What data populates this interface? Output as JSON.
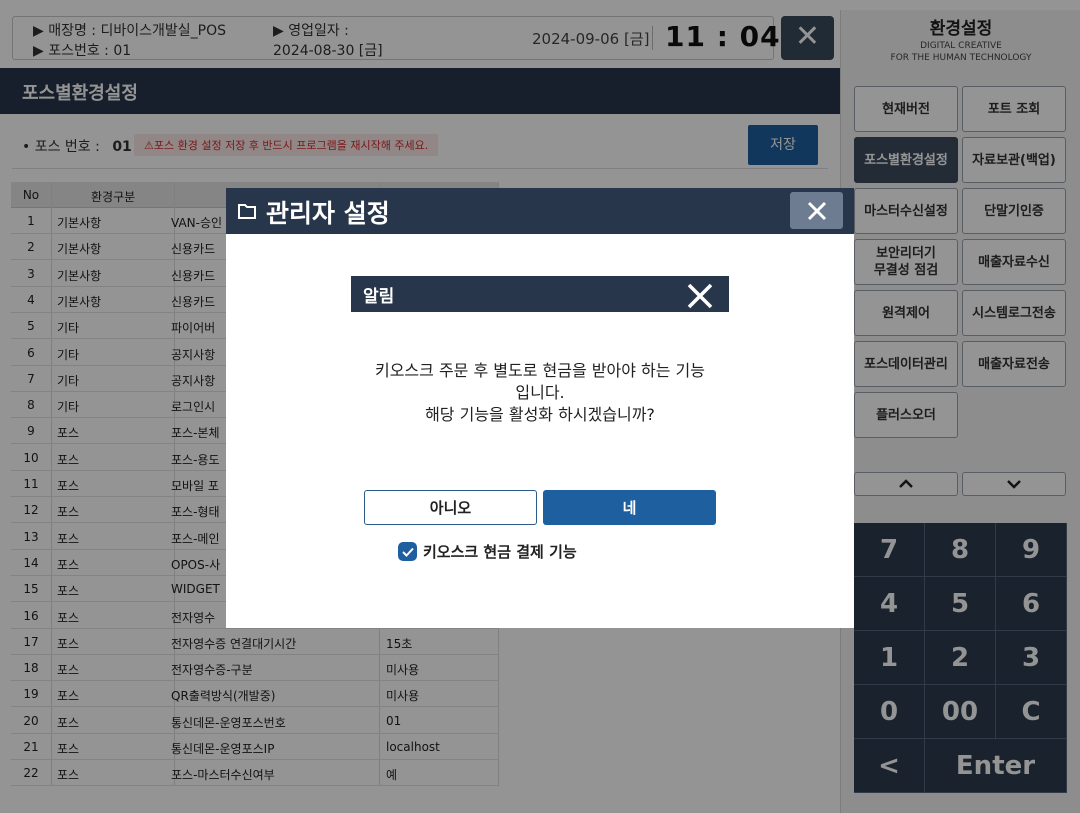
{
  "header": {
    "store_label": "▶ 매장명 : 디바이스개발실_POS",
    "pos_label": "▶ 포스번호 : 01",
    "business_date_label": "▶ 영업일자 :",
    "business_date_value": "2024-08-30 [금]",
    "current_date": "2024-09-06 [금]",
    "clock": "11 : 04",
    "close_icon": "close-icon"
  },
  "page": {
    "title": "포스별환경설정",
    "pos_number_label": "• 포스 번호 :",
    "pos_number_value": "01",
    "warning": "⚠포스 환경 설정 저장 후 반드시 프로그램을 재시작해 주세요.",
    "save_label": "저장"
  },
  "table": {
    "headers": {
      "no": "No",
      "type": "환경구분"
    },
    "rows": [
      {
        "no": "1",
        "type": "기본사항",
        "name": "VAN-승인",
        "value": ""
      },
      {
        "no": "2",
        "type": "기본사항",
        "name": "신용카드",
        "value": ""
      },
      {
        "no": "3",
        "type": "기본사항",
        "name": "신용카드",
        "value": ""
      },
      {
        "no": "4",
        "type": "기본사항",
        "name": "신용카드",
        "value": ""
      },
      {
        "no": "5",
        "type": "기타",
        "name": "파이어버",
        "value": ""
      },
      {
        "no": "6",
        "type": "기타",
        "name": "공지사항",
        "value": ""
      },
      {
        "no": "7",
        "type": "기타",
        "name": "공지사항",
        "value": ""
      },
      {
        "no": "8",
        "type": "기타",
        "name": "로그인시",
        "value": ""
      },
      {
        "no": "9",
        "type": "포스",
        "name": "포스-본체",
        "value": ""
      },
      {
        "no": "10",
        "type": "포스",
        "name": "포스-용도",
        "value": ""
      },
      {
        "no": "11",
        "type": "포스",
        "name": "모바일 포",
        "value": ""
      },
      {
        "no": "12",
        "type": "포스",
        "name": "포스-형태",
        "value": ""
      },
      {
        "no": "13",
        "type": "포스",
        "name": "포스-메인",
        "value": ""
      },
      {
        "no": "14",
        "type": "포스",
        "name": "OPOS-사",
        "value": ""
      },
      {
        "no": "15",
        "type": "포스",
        "name": "WIDGET",
        "value": ""
      },
      {
        "no": "16",
        "type": "포스",
        "name": "전자영수",
        "value": ""
      },
      {
        "no": "17",
        "type": "포스",
        "name": "전자영수증 연결대기시간",
        "value": "15초"
      },
      {
        "no": "18",
        "type": "포스",
        "name": "전자영수증-구분",
        "value": "미사용"
      },
      {
        "no": "19",
        "type": "포스",
        "name": "QR출력방식(개발중)",
        "value": "미사용"
      },
      {
        "no": "20",
        "type": "포스",
        "name": "통신데몬-운영포스번호",
        "value": "01"
      },
      {
        "no": "21",
        "type": "포스",
        "name": "통신데몬-운영포스IP",
        "value": "localhost"
      },
      {
        "no": "22",
        "type": "포스",
        "name": "포스-마스터수신여부",
        "value": "예"
      }
    ]
  },
  "side_panel": {
    "title": "환경설정",
    "subtitle_1": "DIGITAL CREATIVE",
    "subtitle_2": "FOR THE HUMAN TECHNOLOGY",
    "buttons": [
      {
        "label": "현재버전"
      },
      {
        "label": "포트 조회"
      },
      {
        "label": "포스별환경설정",
        "active": true
      },
      {
        "label": "자료보관(백업)"
      },
      {
        "label": "마스터수신설정"
      },
      {
        "label": "단말기인증"
      },
      {
        "label": "보안리더기\n무결성 점검"
      },
      {
        "label": "매출자료수신"
      },
      {
        "label": "원격제어"
      },
      {
        "label": "시스템로그전송"
      },
      {
        "label": "포스데이터관리"
      },
      {
        "label": "매출자료전송"
      },
      {
        "label": "플러스오더"
      }
    ],
    "keypad": [
      "7",
      "8",
      "9",
      "4",
      "5",
      "6",
      "1",
      "2",
      "3",
      "0",
      "00",
      "C",
      "<",
      "Enter"
    ]
  },
  "admin_dialog": {
    "title": "관리자 설정",
    "kiosk_cash_label": "키오스크 현금 결제 기능",
    "kiosk_cash_checked": true
  },
  "alert_dialog": {
    "title": "알림",
    "message_1": "키오스크 주문 후 별도로 현금을 받아야 하는 기능",
    "message_2": "입니다.",
    "message_3": "해당 기능을 활성화 하시겠습니까?",
    "no_label": "아니오",
    "yes_label": "네"
  },
  "colors": {
    "navy": "#27364a",
    "primary_blue": "#1e5fa0",
    "warning_red": "#d32b2b"
  }
}
